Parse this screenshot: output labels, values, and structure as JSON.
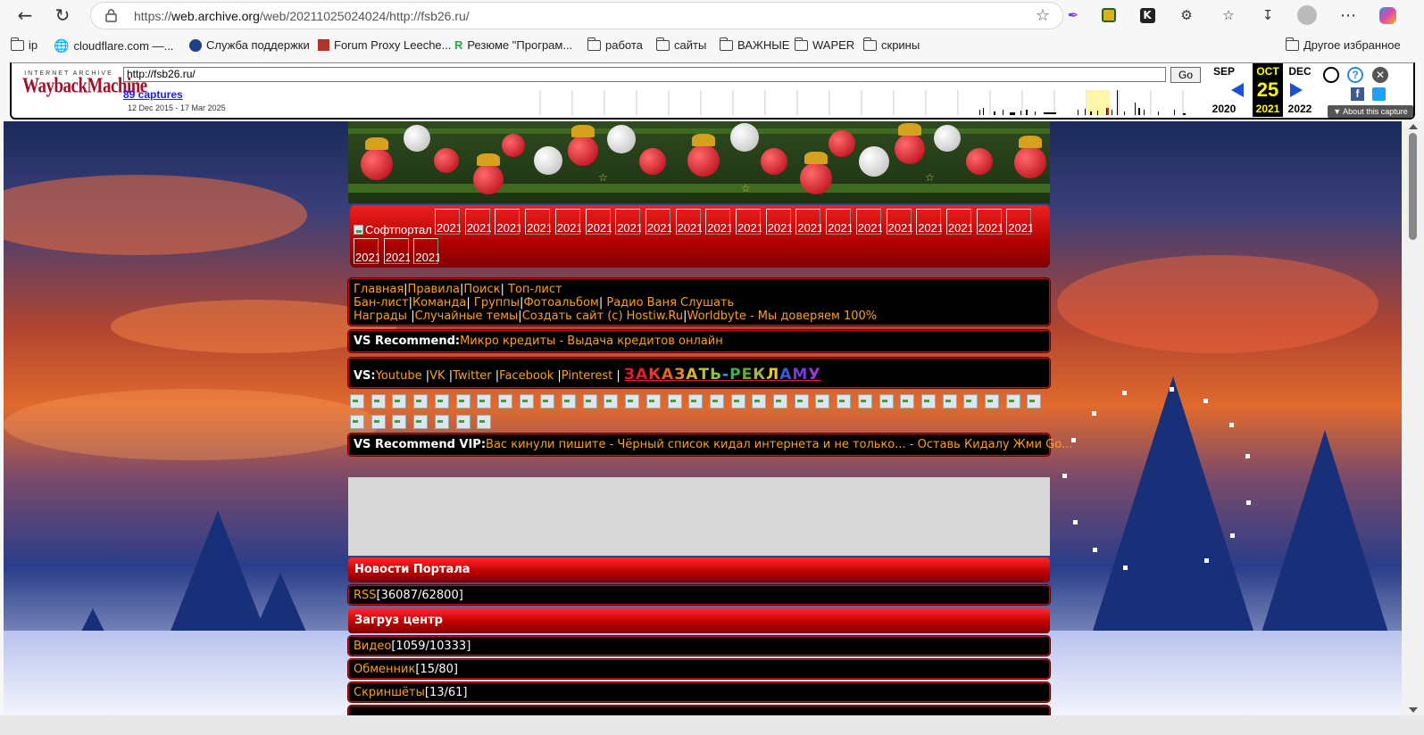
{
  "browser": {
    "url_prefix": "https://",
    "url_host": "web.archive.org",
    "url_path": "/web/20211025024024/http://fsb26.ru/",
    "bookmarks": [
      "ip",
      "cloudflare.com —...",
      "Служба поддержки",
      "Forum Proxy Leeche...",
      "Резюме \"Програм...",
      "работа",
      "сайты",
      "ВАЖНЫЕ",
      "WAPER",
      "скрины"
    ],
    "other_bookmarks": "Другое избранное"
  },
  "wayback": {
    "logo_top": "INTERNET ARCHIVE",
    "logo_main": "WaybackMachine",
    "url_value": "http://fsb26.ru/",
    "go_label": "Go",
    "captures": "89 captures",
    "range": "12 Dec 2015 - 17 Mar 2025",
    "prev_month": "SEP",
    "cur_month": "OCT",
    "next_month": "DEC",
    "cur_day": "25",
    "prev_year": "2020",
    "cur_year": "2021",
    "next_year": "2022",
    "about": "▼ About this capture"
  },
  "site": {
    "logo_alt": "Софтпортал",
    "img_alt": "2021",
    "nav_line1": [
      "Главная",
      "Правила",
      "Поиск",
      " Топ-лист"
    ],
    "nav_line2": [
      "Бан-лист",
      "Команда",
      " Группы",
      "Фотоальбом",
      " Радио Ваня Слушать"
    ],
    "nav_line3": [
      "Награды ",
      "Случайные темы",
      "Создать сайт (c) Hostiw.Ru",
      "Worldbyte - Мы доверяем 100%"
    ],
    "recommend_label": "VS Recommend:",
    "recommend_link": "Микро кредиты - Выдача кредитов онлайн",
    "social_label": "VS:",
    "social_links": [
      "Youtube",
      "VK",
      "Twitter",
      "Facebook",
      "Pinterest"
    ],
    "order_ad": [
      "З",
      "А",
      "К",
      "А",
      "З",
      "А",
      "Т",
      "Ь",
      "-",
      "Р",
      "Е",
      "К",
      "Л",
      "А",
      "М",
      "У"
    ],
    "vip_label": "VS Recommend VIP:",
    "vip_link": "Вас кинули пишите - Чёрный список кидал интернета и не только... - Оставь Кидалу Жми Go...",
    "news_title": "Новости Портала",
    "rss_link": "RSS",
    "rss_count": "[36087/62800]",
    "download_title": "Загруз центр",
    "video_link": "Видео",
    "video_count": "[1059/10333]",
    "exchange_link": "Обменник",
    "exchange_count": "[15/80]",
    "screens_link": "Скриншёты",
    "screens_count": "[13/61]"
  },
  "colors": {
    "link": "#ff9f1a",
    "rainbow": [
      "#e01e2e",
      "#e01e2e",
      "#e33a2a",
      "#e5612a",
      "#e88a2a",
      "#d7b234",
      "#b4c33a",
      "#88c43e",
      "#3a9bd8",
      "#3ab24a",
      "#6ea93a",
      "#a9b63a",
      "#e6c82a",
      "#3a5ad8",
      "#7a3ad8",
      "#9b3ad8"
    ]
  }
}
